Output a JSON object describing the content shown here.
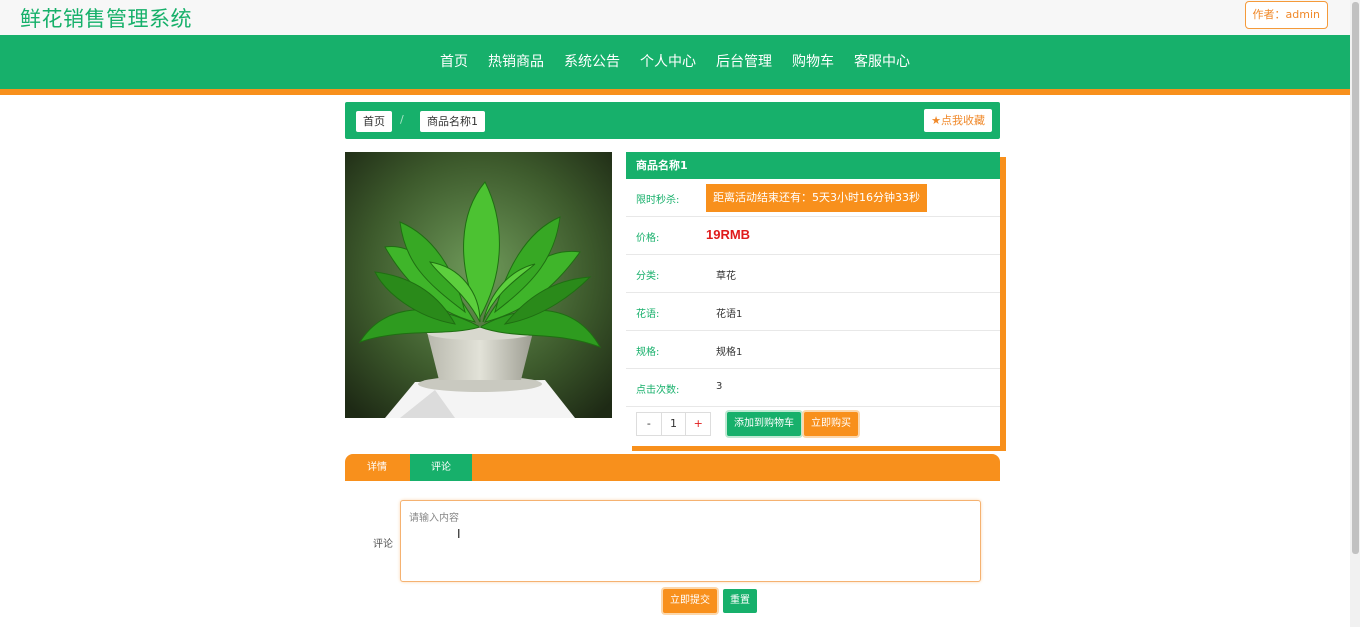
{
  "header": {
    "site_title": "鲜花销售管理系统",
    "author_label": "作者：admin"
  },
  "nav": {
    "items": [
      "首页",
      "热销商品",
      "系统公告",
      "个人中心",
      "后台管理",
      "购物车",
      "客服中心"
    ]
  },
  "breadcrumb": {
    "home": "首页",
    "separator": "/",
    "current": "商品名称1",
    "favorite": "点我收藏"
  },
  "product": {
    "name": "商品名称1",
    "flash_sale_label": "限时秒杀:",
    "countdown": "距离活动结束还有：5天3小时16分钟33秒",
    "price_label": "价格:",
    "price": "19RMB",
    "category_label": "分类:",
    "category": "草花",
    "flower_language_label": "花语:",
    "flower_language": "花语1",
    "spec_label": "规格:",
    "spec": "规格1",
    "clicks_label": "点击次数:",
    "clicks": "3",
    "quantity": "1",
    "minus": "-",
    "plus": "+",
    "add_to_cart": "添加到购物车",
    "buy_now": "立即购买"
  },
  "tabs": {
    "detail": "详情",
    "comment": "评论"
  },
  "comment_form": {
    "label": "评论",
    "placeholder": "请输入内容",
    "submit": "立即提交",
    "reset": "重置"
  },
  "colors": {
    "primary_green": "#17b06b",
    "accent_orange": "#f8901c",
    "price_red": "#e01b1b"
  }
}
